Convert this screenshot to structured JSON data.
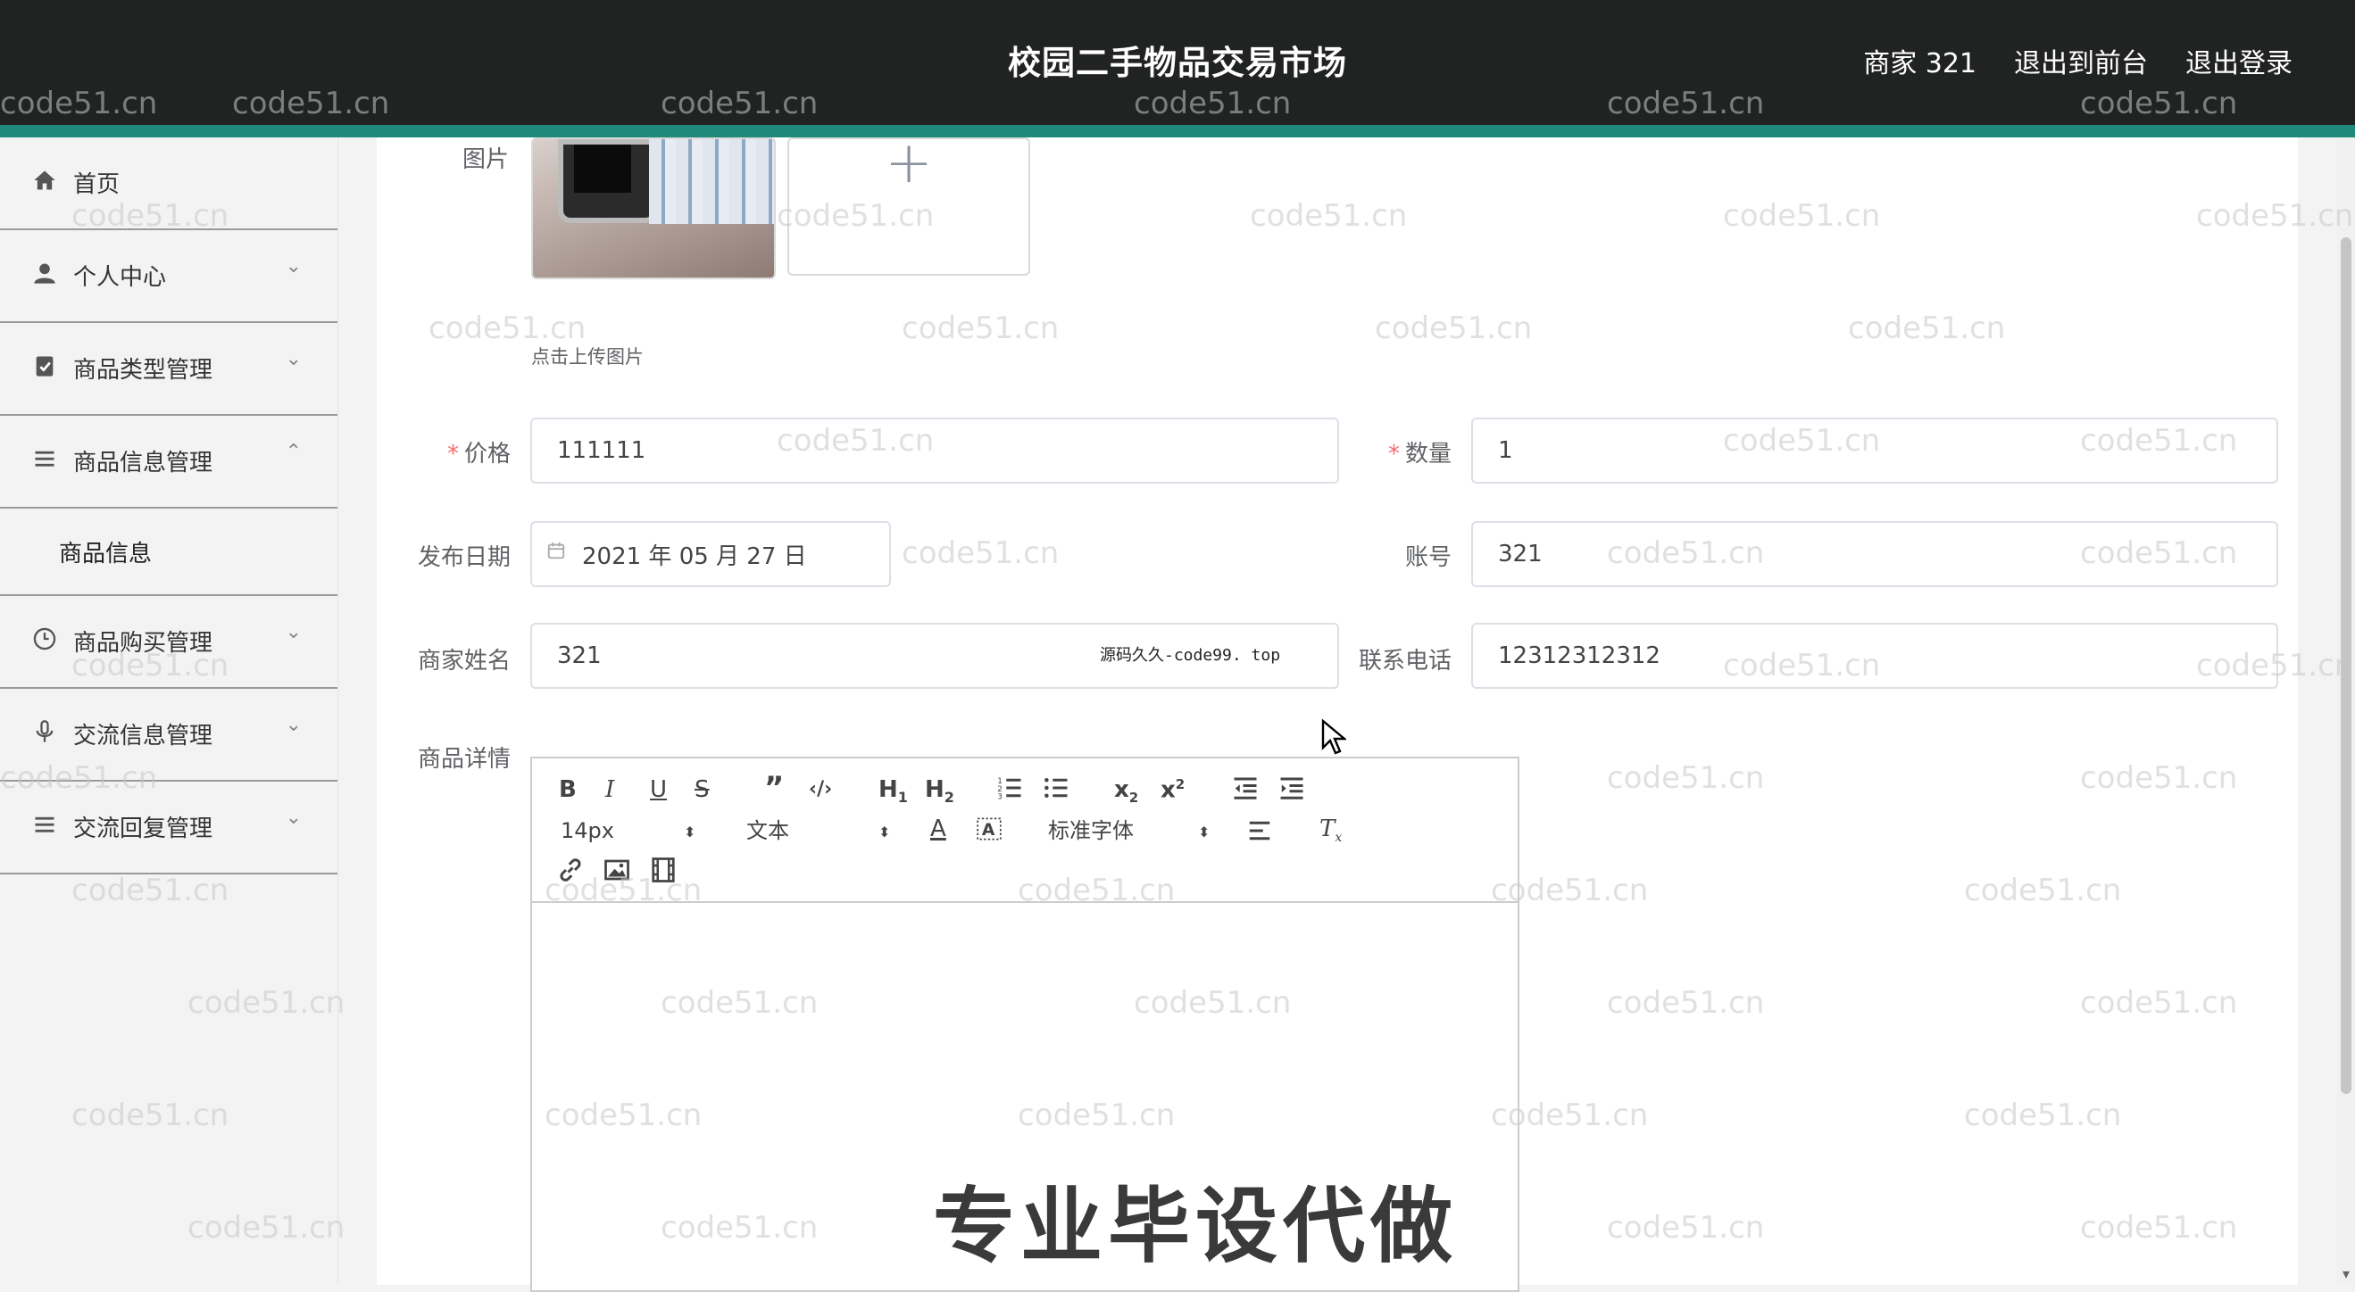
{
  "header": {
    "title": "校园二手物品交易市场",
    "user_label": "商家 321",
    "exit_front": "退出到前台",
    "logout": "退出登录"
  },
  "sidebar": {
    "items": [
      {
        "label": "首页",
        "icon": "home-icon"
      },
      {
        "label": "个人中心",
        "icon": "user-icon"
      },
      {
        "label": "商品类型管理",
        "icon": "clipboard-icon"
      },
      {
        "label": "商品信息管理",
        "icon": "list-icon"
      },
      {
        "label": "商品购买管理",
        "icon": "clock-icon"
      },
      {
        "label": "交流信息管理",
        "icon": "microphone-icon"
      },
      {
        "label": "交流回复管理",
        "icon": "list-icon"
      }
    ],
    "sub_item": "商品信息"
  },
  "form": {
    "image_label": "图片",
    "upload_hint": "点击上传图片",
    "price_label": "价格",
    "price_value": "111111",
    "quantity_label": "数量",
    "quantity_value": "1",
    "date_label": "发布日期",
    "date_value": "2021 年 05 月 27 日",
    "account_label": "账号",
    "account_value": "321",
    "merchant_label": "商家姓名",
    "merchant_value": "321",
    "phone_label": "联系电话",
    "phone_value": "12312312312",
    "detail_label": "商品详情"
  },
  "editor": {
    "font_size": "14px",
    "block_type": "文本",
    "font_family": "标准字体"
  },
  "overlay": {
    "watermark": "code51.cn",
    "small_mark": "源码久久-code99. top",
    "promo": "专业毕设代做"
  }
}
